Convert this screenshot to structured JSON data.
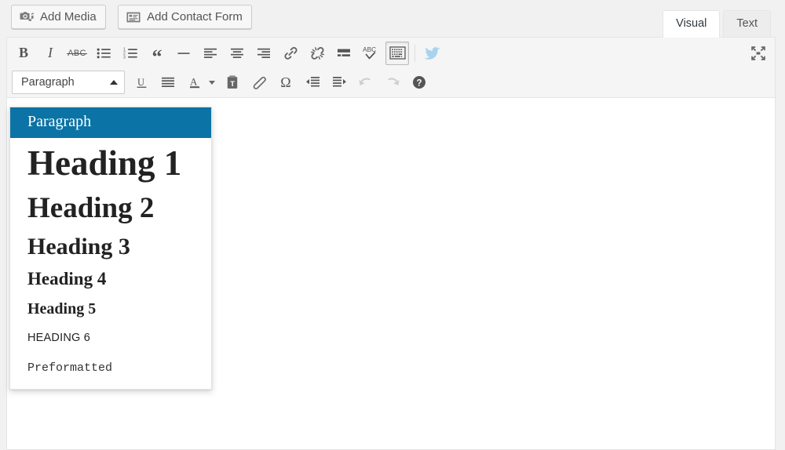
{
  "media_bar": {
    "buttons": [
      {
        "label": "Add Media",
        "icon": "camera-music-icon"
      },
      {
        "label": "Add Contact Form",
        "icon": "form-list-icon"
      }
    ]
  },
  "tabs": [
    {
      "label": "Visual",
      "active": true
    },
    {
      "label": "Text",
      "active": false
    }
  ],
  "toolbar": {
    "row1": [
      {
        "name": "bold",
        "title": "Bold",
        "glyph": "B"
      },
      {
        "name": "italic",
        "title": "Italic",
        "glyph": "I"
      },
      {
        "name": "strikethrough",
        "title": "Strikethrough",
        "glyph": "ABC"
      },
      {
        "name": "bullist",
        "title": "Bulleted list"
      },
      {
        "name": "numlist",
        "title": "Numbered list"
      },
      {
        "name": "blockquote",
        "title": "Blockquote",
        "glyph": "“"
      },
      {
        "name": "hr",
        "title": "Horizontal line",
        "glyph": "—"
      },
      {
        "name": "alignleft",
        "title": "Align left"
      },
      {
        "name": "aligncenter",
        "title": "Align center"
      },
      {
        "name": "alignright",
        "title": "Align right"
      },
      {
        "name": "link",
        "title": "Insert/edit link"
      },
      {
        "name": "unlink",
        "title": "Remove link"
      },
      {
        "name": "readmore",
        "title": "Insert Read More tag"
      },
      {
        "name": "spellcheck",
        "title": "Spellcheck",
        "glyph": "ABC"
      },
      {
        "name": "toolbar-toggle",
        "title": "Toolbar Toggle",
        "active": true
      },
      {
        "name": "twitter",
        "title": "Twitter"
      },
      {
        "name": "fullscreen",
        "title": "Distraction-free writing mode"
      }
    ],
    "row2": [
      {
        "name": "format-select",
        "title": "Paragraph"
      },
      {
        "name": "underline",
        "title": "Underline",
        "glyph": "U"
      },
      {
        "name": "justify",
        "title": "Justify"
      },
      {
        "name": "textcolor",
        "title": "Text color",
        "glyph": "A"
      },
      {
        "name": "pastetext",
        "title": "Paste as text"
      },
      {
        "name": "removeformat",
        "title": "Clear formatting"
      },
      {
        "name": "charmap",
        "title": "Special character",
        "glyph": "Ω"
      },
      {
        "name": "outdent",
        "title": "Decrease indent"
      },
      {
        "name": "indent",
        "title": "Increase indent"
      },
      {
        "name": "undo",
        "title": "Undo",
        "disabled": true
      },
      {
        "name": "redo",
        "title": "Redo",
        "disabled": true
      },
      {
        "name": "help",
        "title": "Keyboard Shortcuts",
        "glyph": "?"
      }
    ],
    "format_select": {
      "value": "Paragraph",
      "caret": "up"
    }
  },
  "format_menu": {
    "open": true,
    "highlight_color": "#0b73a5",
    "items": [
      {
        "label": "Paragraph",
        "style": "fi-paragraph",
        "selected": true
      },
      {
        "label": "Heading 1",
        "style": "fi-h1",
        "selected": false
      },
      {
        "label": "Heading 2",
        "style": "fi-h2",
        "selected": false
      },
      {
        "label": "Heading 3",
        "style": "fi-h3",
        "selected": false
      },
      {
        "label": "Heading 4",
        "style": "fi-h4",
        "selected": false
      },
      {
        "label": "Heading 5",
        "style": "fi-h5",
        "selected": false
      },
      {
        "label": "HEADING 6",
        "style": "fi-h6",
        "selected": false
      },
      {
        "label": "Preformatted",
        "style": "fi-pre",
        "selected": false
      }
    ]
  },
  "content": {
    "body_text": ""
  }
}
